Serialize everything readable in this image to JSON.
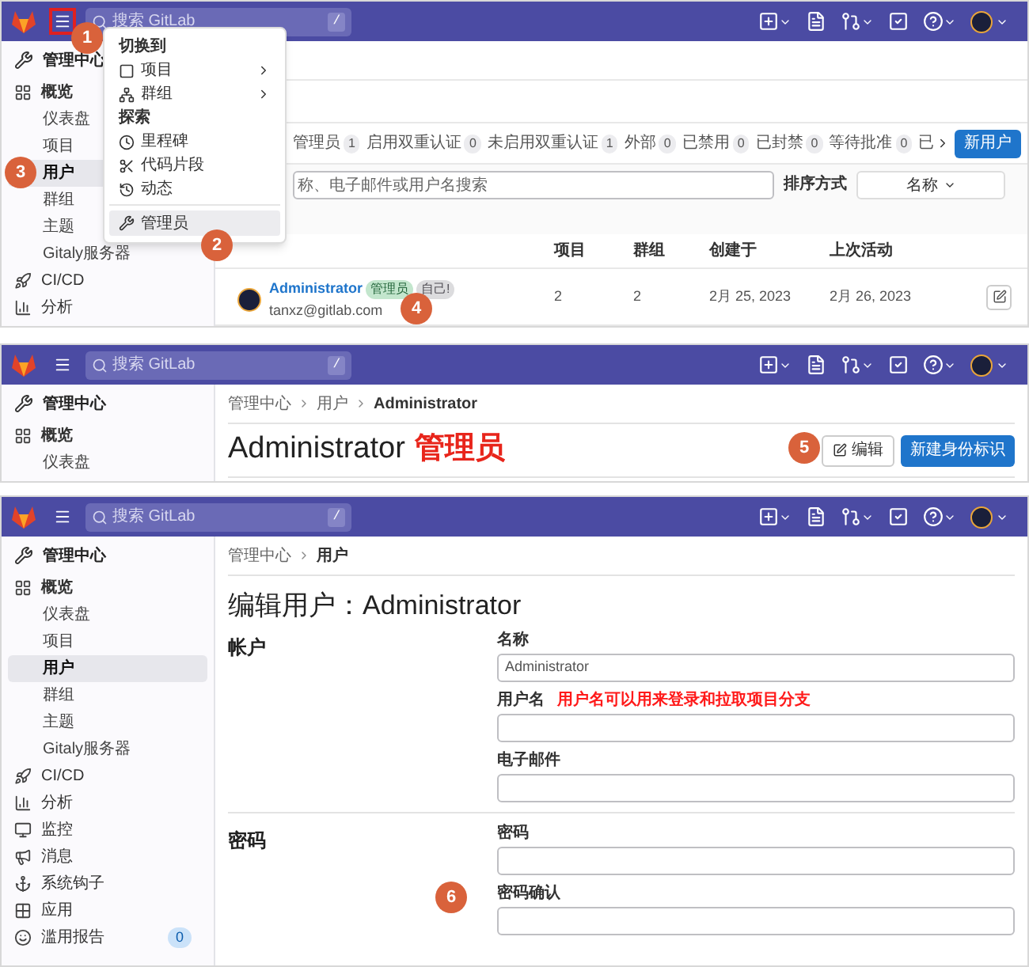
{
  "panels": [
    {
      "kind": "user_list",
      "navbar": {
        "menu_highlighted": true,
        "search_placeholder": "搜索 GitLab",
        "shortcut": "/"
      },
      "sidebar": {
        "title": "管理中心",
        "items": [
          {
            "label": "概览",
            "expanded": true,
            "children": [
              {
                "label": "仪表盘",
                "selected": false
              },
              {
                "label": "项目",
                "selected": false
              },
              {
                "label": "用户",
                "selected": true
              },
              {
                "label": "群组",
                "selected": false
              },
              {
                "label": "主题",
                "selected": false
              },
              {
                "label": "Gitaly服务器",
                "selected": false
              }
            ]
          },
          {
            "label": "CI/CD"
          },
          {
            "label": "分析"
          }
        ]
      },
      "menu": {
        "sections": [
          {
            "heading": "切换到",
            "items": [
              {
                "label": "项目",
                "submenu": true,
                "selected": false
              },
              {
                "label": "群组",
                "submenu": true,
                "selected": false
              }
            ]
          },
          {
            "heading": "探索",
            "items": [
              {
                "label": "里程碑",
                "submenu": false,
                "selected": false
              },
              {
                "label": "代码片段",
                "submenu": false,
                "selected": false
              },
              {
                "label": "动态",
                "submenu": false,
                "selected": false
              }
            ]
          },
          {
            "items": [
              {
                "label": "管理员",
                "submenu": false,
                "selected": true
              }
            ]
          }
        ]
      },
      "tabs": [
        {
          "label": "管理员",
          "count": "1"
        },
        {
          "label": "启用双重认证",
          "count": "0"
        },
        {
          "label": "未启用双重认证",
          "count": "1"
        },
        {
          "label": "外部",
          "count": "0"
        },
        {
          "label": "已禁用",
          "count": "0"
        },
        {
          "label": "已封禁",
          "count": "0"
        },
        {
          "label": "等待批准",
          "count": "0"
        },
        {
          "label": "已"
        }
      ],
      "new_user_button": "新用户",
      "search_placeholder": "称、电子邮件或用户名搜索",
      "sort_label": "排序方式",
      "sort_value": "名称",
      "table": {
        "columns": [
          "项目",
          "群组",
          "创建于",
          "上次活动"
        ],
        "rows": [
          {
            "name": "Administrator",
            "badges": [
              {
                "label": "管理员",
                "kind": "admin"
              },
              {
                "label": "自己!",
                "kind": "self"
              }
            ],
            "email": "tanxz@gitlab.com",
            "projects": "2",
            "groups": "2",
            "created": "2月 25, 2023",
            "last_activity": "2月 26, 2023"
          }
        ]
      },
      "markers": [
        "1",
        "2",
        "3",
        "4"
      ]
    },
    {
      "kind": "user_detail",
      "navbar": {
        "menu_highlighted": false,
        "search_placeholder": "搜索 GitLab",
        "shortcut": "/"
      },
      "sidebar": {
        "title": "管理中心",
        "items": [
          {
            "label": "概览",
            "expanded": true,
            "children": [
              {
                "label": "仪表盘",
                "selected": false
              }
            ]
          }
        ]
      },
      "breadcrumbs": [
        "管理中心",
        "用户",
        "Administrator"
      ],
      "title": "Administrator",
      "title_note": "管理员",
      "edit_button": "编辑",
      "new_identity_button": "新建身份标识",
      "markers": [
        "5"
      ]
    },
    {
      "kind": "edit_user",
      "navbar": {
        "menu_highlighted": false,
        "search_placeholder": "搜索 GitLab",
        "shortcut": "/"
      },
      "sidebar": {
        "title": "管理中心",
        "items": [
          {
            "label": "概览",
            "expanded": true,
            "children": [
              {
                "label": "仪表盘",
                "selected": false
              },
              {
                "label": "项目",
                "selected": false
              },
              {
                "label": "用户",
                "selected": true
              },
              {
                "label": "群组",
                "selected": false
              },
              {
                "label": "主题",
                "selected": false
              },
              {
                "label": "Gitaly服务器",
                "selected": false
              }
            ]
          },
          {
            "label": "CI/CD"
          },
          {
            "label": "分析"
          },
          {
            "label": "监控"
          },
          {
            "label": "消息"
          },
          {
            "label": "系统钩子"
          },
          {
            "label": "应用"
          },
          {
            "label": "滥用报告",
            "count": "0"
          }
        ]
      },
      "breadcrumbs": [
        "管理中心",
        "用户"
      ],
      "title": "编辑用户：Administrator",
      "sections": [
        {
          "heading": "帐户",
          "fields": [
            {
              "label": "名称",
              "value": "Administrator"
            },
            {
              "label": "用户名",
              "note": "用户名可以用来登录和拉取项目分支"
            },
            {
              "label": "电子邮件"
            }
          ]
        },
        {
          "heading": "密码",
          "fields": [
            {
              "label": "密码"
            },
            {
              "label": "密码确认"
            }
          ]
        }
      ],
      "markers": [
        "6"
      ]
    }
  ]
}
